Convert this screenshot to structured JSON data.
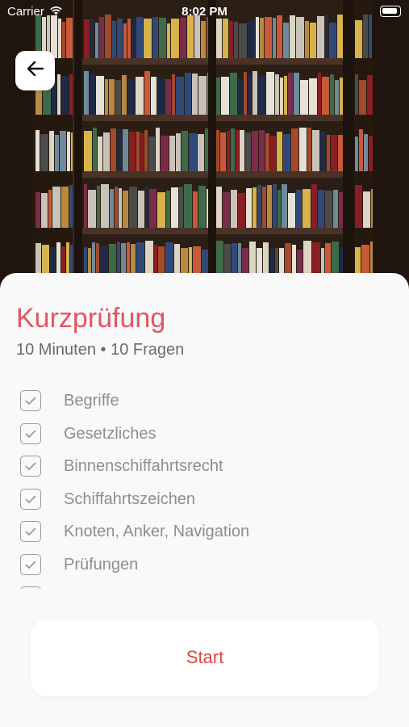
{
  "status_bar": {
    "carrier": "Carrier",
    "time": "8:02 PM",
    "wifi_icon": "wifi-icon",
    "battery_icon": "battery-icon"
  },
  "header": {
    "back_icon": "arrow-left-icon",
    "hero_image": "bookshelf-photo"
  },
  "quiz": {
    "title": "Kurzprüfung",
    "subtitle": "10 Minuten • 10 Fragen",
    "categories": [
      {
        "label": "Begriffe",
        "checked": true
      },
      {
        "label": "Gesetzliches",
        "checked": true
      },
      {
        "label": "Binnenschiffahrtsrecht",
        "checked": true
      },
      {
        "label": "Schiffahrtszeichen",
        "checked": true
      },
      {
        "label": "Knoten, Anker, Navigation",
        "checked": true
      },
      {
        "label": "Prüfungen",
        "checked": true
      },
      {
        "label": "",
        "checked": true
      }
    ],
    "start_label": "Start"
  },
  "colors": {
    "accent": "#e55561",
    "start_text": "#e0453f",
    "checkbox": "#9a9a9a",
    "label": "#8e8e8e"
  }
}
